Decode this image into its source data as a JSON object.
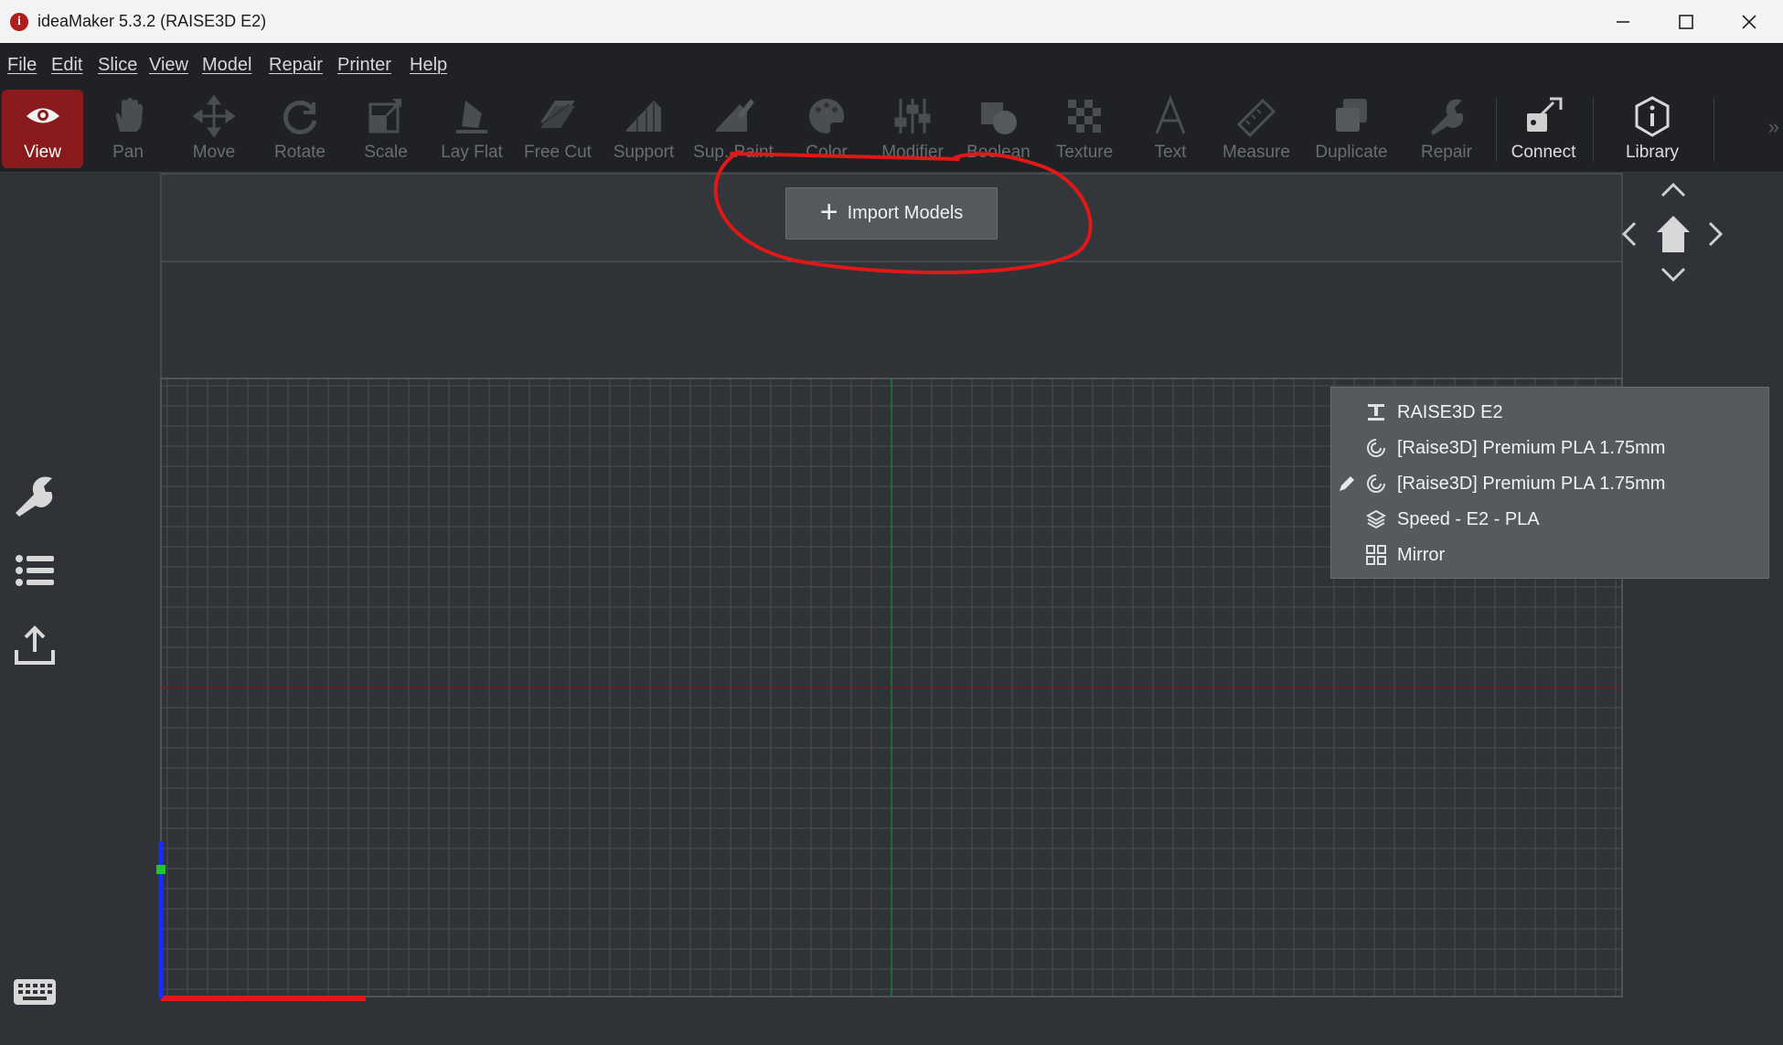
{
  "window": {
    "title": "ideaMaker 5.3.2 (RAISE3D E2)"
  },
  "menu": [
    {
      "id": "file",
      "label": "File"
    },
    {
      "id": "edit",
      "label": "Edit"
    },
    {
      "id": "slice",
      "label": "Slice"
    },
    {
      "id": "view",
      "label": "View"
    },
    {
      "id": "model",
      "label": "Model"
    },
    {
      "id": "repair",
      "label": "Repair"
    },
    {
      "id": "printer",
      "label": "Printer"
    },
    {
      "id": "help",
      "label": "Help"
    }
  ],
  "toolbar": [
    {
      "id": "view",
      "label": "View",
      "icon": "eye-icon",
      "state": "active"
    },
    {
      "id": "pan",
      "label": "Pan",
      "icon": "hand-icon",
      "state": "disabled"
    },
    {
      "id": "move",
      "label": "Move",
      "icon": "move-arrows-icon",
      "state": "disabled"
    },
    {
      "id": "rotate",
      "label": "Rotate",
      "icon": "rotate-icon",
      "state": "disabled"
    },
    {
      "id": "scale",
      "label": "Scale",
      "icon": "scale-icon",
      "state": "disabled"
    },
    {
      "id": "lay-flat",
      "label": "Lay Flat",
      "icon": "lay-flat-icon",
      "state": "disabled"
    },
    {
      "id": "free-cut",
      "label": "Free Cut",
      "icon": "free-cut-icon",
      "state": "disabled"
    },
    {
      "id": "support",
      "label": "Support",
      "icon": "support-icon",
      "state": "disabled"
    },
    {
      "id": "sup-paint",
      "label": "Sup. Paint",
      "icon": "support-paint-icon",
      "state": "disabled"
    },
    {
      "id": "color",
      "label": "Color",
      "icon": "palette-icon",
      "state": "disabled"
    },
    {
      "id": "modifier",
      "label": "Modifier",
      "icon": "sliders-icon",
      "state": "disabled"
    },
    {
      "id": "boolean",
      "label": "Boolean",
      "icon": "boolean-icon",
      "state": "disabled"
    },
    {
      "id": "texture",
      "label": "Texture",
      "icon": "checker-icon",
      "state": "disabled"
    },
    {
      "id": "text",
      "label": "Text",
      "icon": "text-a-icon",
      "state": "disabled"
    },
    {
      "id": "measure",
      "label": "Measure",
      "icon": "ruler-icon",
      "state": "disabled"
    },
    {
      "id": "duplicate",
      "label": "Duplicate",
      "icon": "duplicate-icon",
      "state": "disabled"
    },
    {
      "id": "repair",
      "label": "Repair",
      "icon": "wrench-icon",
      "state": "disabled"
    },
    {
      "id": "connect",
      "label": "Connect",
      "icon": "connect-icon",
      "state": "enabled"
    },
    {
      "id": "library",
      "label": "Library",
      "icon": "info-shield-icon",
      "state": "enabled"
    }
  ],
  "import_button": {
    "label": "Import Models",
    "icon": "plus-icon"
  },
  "profile_panel": {
    "items": [
      {
        "id": "printer",
        "label": "RAISE3D E2",
        "icon": "printer-icon",
        "editable": false
      },
      {
        "id": "filament-left",
        "label": "[Raise3D] Premium PLA 1.75mm",
        "icon": "filament-icon",
        "editable": false
      },
      {
        "id": "filament-right",
        "label": "[Raise3D] Premium PLA 1.75mm",
        "icon": "filament-icon",
        "editable": true
      },
      {
        "id": "print-template",
        "label": "Speed - E2 - PLA",
        "icon": "layers-icon",
        "editable": false
      },
      {
        "id": "print-mode",
        "label": "Mirror",
        "icon": "mirror-grid-icon",
        "editable": false
      }
    ]
  },
  "sidebar": [
    {
      "id": "settings",
      "icon": "wrench-icon"
    },
    {
      "id": "model-list",
      "icon": "list-icon"
    },
    {
      "id": "export",
      "icon": "upload-icon"
    },
    {
      "id": "shortcuts",
      "icon": "keyboard-icon"
    }
  ],
  "colors": {
    "active_tool": "#8b1a1d",
    "annotation": "#e01818",
    "x_axis": "#e01818",
    "y_axis_marker": "#8a1f24",
    "z_axis": "#1a2bff",
    "center_line": "#1e7a2e"
  }
}
